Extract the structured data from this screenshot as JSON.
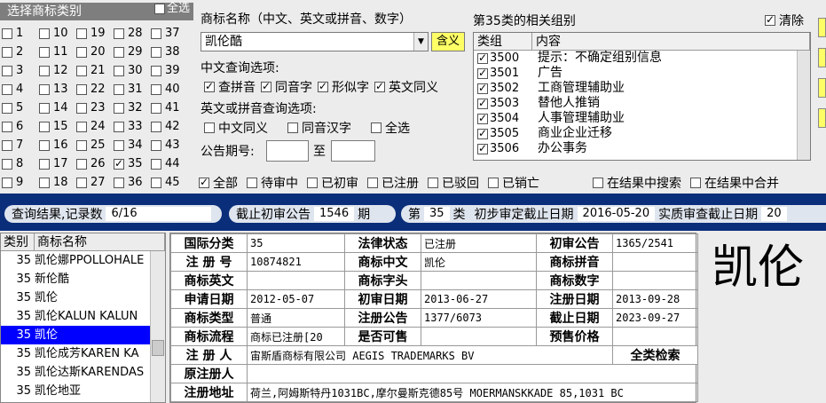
{
  "category_panel": {
    "title": "选择商标类别",
    "select_all_label": "全选",
    "classes": [
      {
        "n": "1",
        "checked": false
      },
      {
        "n": "10",
        "checked": false
      },
      {
        "n": "19",
        "checked": false
      },
      {
        "n": "28",
        "checked": false
      },
      {
        "n": "37",
        "checked": false
      },
      {
        "n": "2",
        "checked": false
      },
      {
        "n": "11",
        "checked": false
      },
      {
        "n": "20",
        "checked": false
      },
      {
        "n": "29",
        "checked": false
      },
      {
        "n": "38",
        "checked": false
      },
      {
        "n": "3",
        "checked": false
      },
      {
        "n": "12",
        "checked": false
      },
      {
        "n": "21",
        "checked": false
      },
      {
        "n": "30",
        "checked": false
      },
      {
        "n": "39",
        "checked": false
      },
      {
        "n": "4",
        "checked": false
      },
      {
        "n": "13",
        "checked": false
      },
      {
        "n": "22",
        "checked": false
      },
      {
        "n": "31",
        "checked": false
      },
      {
        "n": "40",
        "checked": false
      },
      {
        "n": "5",
        "checked": false
      },
      {
        "n": "14",
        "checked": false
      },
      {
        "n": "23",
        "checked": false
      },
      {
        "n": "32",
        "checked": false
      },
      {
        "n": "41",
        "checked": false
      },
      {
        "n": "6",
        "checked": false
      },
      {
        "n": "15",
        "checked": false
      },
      {
        "n": "24",
        "checked": false
      },
      {
        "n": "33",
        "checked": false
      },
      {
        "n": "42",
        "checked": false
      },
      {
        "n": "7",
        "checked": false
      },
      {
        "n": "16",
        "checked": false
      },
      {
        "n": "25",
        "checked": false
      },
      {
        "n": "34",
        "checked": false
      },
      {
        "n": "43",
        "checked": false
      },
      {
        "n": "8",
        "checked": false
      },
      {
        "n": "17",
        "checked": false
      },
      {
        "n": "26",
        "checked": false
      },
      {
        "n": "35",
        "checked": true
      },
      {
        "n": "44",
        "checked": false
      },
      {
        "n": "9",
        "checked": false
      },
      {
        "n": "18",
        "checked": false
      },
      {
        "n": "27",
        "checked": false
      },
      {
        "n": "36",
        "checked": false
      },
      {
        "n": "45",
        "checked": false
      }
    ]
  },
  "search": {
    "name_label": "商标名称（中文、英文或拼音、数字）",
    "name_value": "凯伦酷",
    "meaning_button": "含义",
    "cn_options_label": "中文查询选项:",
    "cn_options": [
      {
        "label": "查拼音",
        "checked": true
      },
      {
        "label": "同音字",
        "checked": true
      },
      {
        "label": "形似字",
        "checked": true
      },
      {
        "label": "英文同义",
        "checked": true
      }
    ],
    "en_options_label": "英文或拼音查询选项:",
    "en_options": [
      {
        "label": "中文同义",
        "checked": false
      },
      {
        "label": "同音汉字",
        "checked": false
      },
      {
        "label": "全选",
        "checked": false
      }
    ],
    "announce_label": "公告期号:",
    "announce_to": "至"
  },
  "groups": {
    "title": "第35类的相关组别",
    "clear_label": "清除",
    "clear_checked": true,
    "col_group": "类组",
    "col_content": "内容",
    "rows": [
      {
        "code": "3500",
        "text": "提示：不确定组别信息",
        "checked": true
      },
      {
        "code": "3501",
        "text": "广告",
        "checked": true
      },
      {
        "code": "3502",
        "text": "工商管理辅助业",
        "checked": true
      },
      {
        "code": "3503",
        "text": "替他人推销",
        "checked": true
      },
      {
        "code": "3504",
        "text": "人事管理辅助业",
        "checked": true
      },
      {
        "code": "3505",
        "text": "商业企业迁移",
        "checked": true
      },
      {
        "code": "3506",
        "text": "办公事务",
        "checked": true
      }
    ]
  },
  "filters": [
    {
      "label": "全部",
      "checked": true
    },
    {
      "label": "待审中",
      "checked": false
    },
    {
      "label": "已初审",
      "checked": false
    },
    {
      "label": "已注册",
      "checked": false
    },
    {
      "label": "已驳回",
      "checked": false
    },
    {
      "label": "已销亡",
      "checked": false
    }
  ],
  "result_options": [
    {
      "label": "在结果中搜索",
      "checked": false
    },
    {
      "label": "在结果中合并",
      "checked": false
    }
  ],
  "status_bar": {
    "result_label": "查询结果,记录数",
    "result_value": "6/16",
    "cutoff_label": "截止初审公告",
    "cutoff_value": "1546",
    "cutoff_unit": "期",
    "class_prefix": "第",
    "class_value": "35",
    "class_suffix": "类",
    "prelim_label": "初步审定截止日期",
    "prelim_value": "2016-05-20",
    "substantive_label": "实质审查截止日期",
    "substantive_value": "20"
  },
  "result_list": {
    "col_class": "类别",
    "col_name": "商标名称",
    "rows": [
      {
        "cls": "35",
        "name": "凯伦娜PPOLLOHALE",
        "selected": false
      },
      {
        "cls": "35",
        "name": "新伦酷",
        "selected": false
      },
      {
        "cls": "35",
        "name": "凯伦",
        "selected": false
      },
      {
        "cls": "35",
        "name": "凯伦KALUN KALUN",
        "selected": false
      },
      {
        "cls": "35",
        "name": "凯伦",
        "selected": true
      },
      {
        "cls": "35",
        "name": "凯伦成芳KAREN KA",
        "selected": false
      },
      {
        "cls": "35",
        "name": "凯伦达斯KARENDAS",
        "selected": false
      },
      {
        "cls": "35",
        "name": "凯伦地亚",
        "selected": false
      }
    ]
  },
  "detail": {
    "intl_class_label": "国际分类",
    "intl_class": "35",
    "legal_status_label": "法律状态",
    "legal_status": "已注册",
    "prelim_ann_label": "初审公告",
    "prelim_ann": "1365/2541",
    "reg_no_label": "注 册 号",
    "reg_no": "10874821",
    "cn_name_label": "商标中文",
    "cn_name": "凯伦",
    "pinyin_label": "商标拼音",
    "pinyin": "",
    "en_name_label": "商标英文",
    "en_name": "",
    "initial_label": "商标字头",
    "initial": "",
    "digits_label": "商标数字",
    "digits": "",
    "apply_date_label": "申请日期",
    "apply_date": "2012-05-07",
    "prelim_date_label": "初审日期",
    "prelim_date": "2013-06-27",
    "reg_date_label": "注册日期",
    "reg_date": "2013-09-28",
    "type_label": "商标类型",
    "type": "普通",
    "reg_ann_label": "注册公告",
    "reg_ann": "1377/6073",
    "expiry_label": "截止日期",
    "expiry": "2023-09-27",
    "flow_label": "商标流程",
    "flow": "商标已注册[20",
    "saleable_label": "是否可售",
    "saleable": "",
    "presale_label": "预售价格",
    "presale": "",
    "registrant_label": "注 册 人",
    "registrant": "宙斯盾商标有限公司 AEGIS TRADEMARKS BV",
    "all_class_search": "全类检索",
    "orig_registrant_label": "原注册人",
    "orig_registrant": "",
    "address_label": "注册地址",
    "address": "荷兰,阿姆斯特丹1031BC,摩尔曼斯克德85号 MOERMANSKKADE 85,1031 BC"
  },
  "preview_name": "凯伦"
}
